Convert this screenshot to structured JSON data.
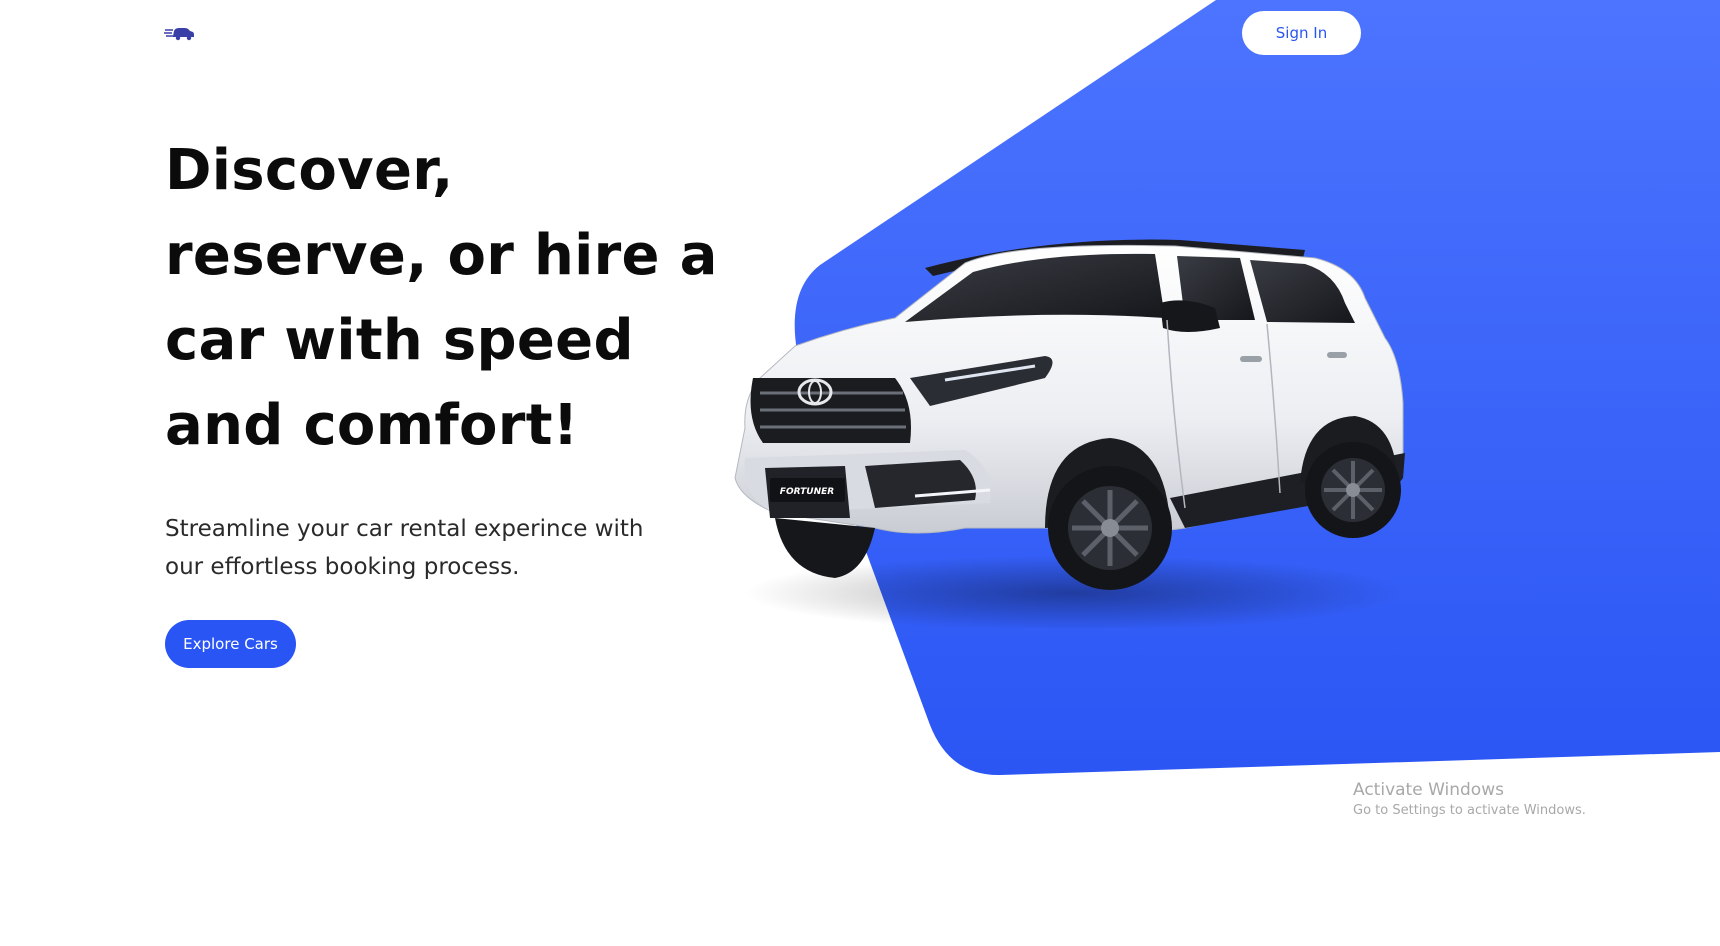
{
  "header": {
    "logo_icon": "car-speed-icon",
    "sign_in_label": "Sign In"
  },
  "hero": {
    "title_lines": [
      "Discover,",
      "reserve, or hire a",
      "car with speed",
      "and comfort!"
    ],
    "subtitle_lines": [
      "Streamline your car rental experince with",
      "our effortless booking process."
    ],
    "cta_label": "Explore Cars",
    "image_icon": "suv-car-image"
  },
  "os_watermark": {
    "title": "Activate Windows",
    "subtitle": "Go to Settings to activate Windows."
  },
  "colors": {
    "accent": "#2a55f5",
    "accent_light": "#4c74ff",
    "text_dark": "#0b0b0b",
    "background": "#ffffff"
  }
}
